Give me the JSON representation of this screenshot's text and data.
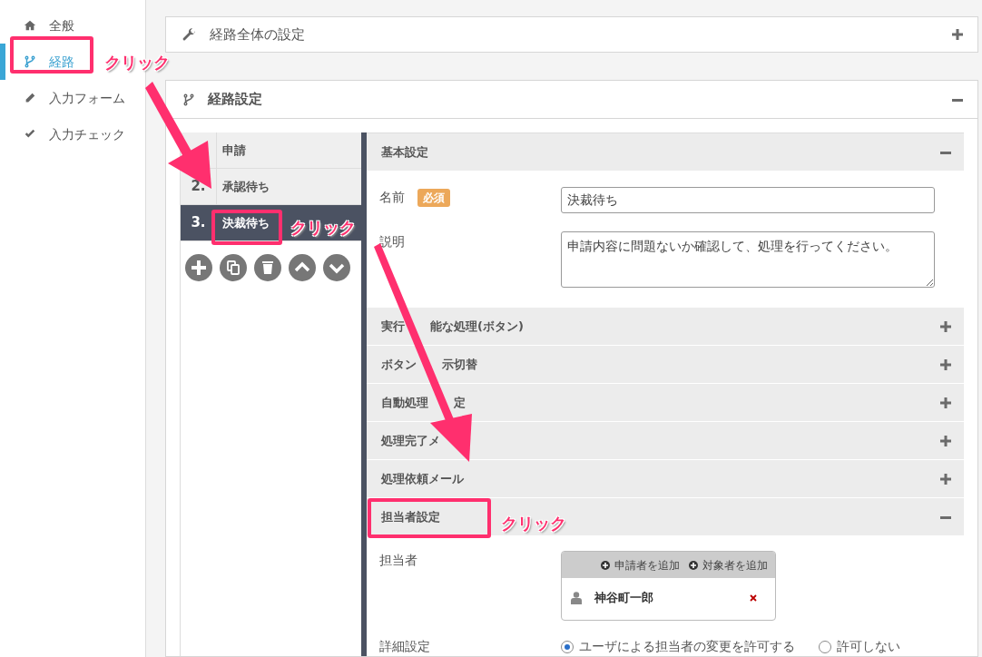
{
  "sidebar": {
    "items": [
      {
        "label": "全般",
        "selected": false
      },
      {
        "label": "経路",
        "selected": true
      },
      {
        "label": "入力フォーム",
        "selected": false
      },
      {
        "label": "入力チェック",
        "selected": false
      }
    ]
  },
  "global_panel": {
    "title": "経路全体の設定",
    "expanded": false
  },
  "route_panel": {
    "title": "経路設定",
    "expanded": true,
    "steps": [
      {
        "label": "申請",
        "selected": false
      },
      {
        "number": "2.",
        "label": "承認待ち",
        "selected": false
      },
      {
        "number": "3.",
        "label": "決裁待ち",
        "selected": true
      }
    ],
    "sections": [
      {
        "kind": "form",
        "title_parts": [
          "基本設定"
        ],
        "expanded": true,
        "fields": [
          {
            "kind": "input",
            "label": "名前",
            "badge": "必須",
            "value": "決裁待ち"
          },
          {
            "kind": "textarea",
            "label": "説明",
            "value": "申請内容に問題ないか確認して、処理を行ってください。"
          }
        ]
      },
      {
        "kind": "plain",
        "title_parts": [
          "実行",
          "能な処理(ボタン)"
        ],
        "expanded": false
      },
      {
        "kind": "plain",
        "title_parts": [
          "ボタン",
          "示切替"
        ],
        "expanded": false
      },
      {
        "kind": "plain",
        "title_parts": [
          "自動処理",
          "定"
        ],
        "expanded": false
      },
      {
        "kind": "plain",
        "title_parts": [
          "処理完了メ"
        ],
        "expanded": false
      },
      {
        "kind": "plain",
        "title_parts": [
          "処理依頼メール"
        ],
        "expanded": false
      },
      {
        "kind": "assignee",
        "title_parts": [
          "担当者設定"
        ],
        "expanded": true,
        "assignee_label": "担当者",
        "add_buttons": [
          "申請者を追加",
          "対象者を追加"
        ],
        "people": [
          "神谷町一郎"
        ],
        "detail_label": "詳細設定",
        "options": [
          {
            "label": "ユーザによる担当者の変更を許可する",
            "selected": true
          },
          {
            "label": "許可しない",
            "selected": false
          }
        ]
      }
    ]
  },
  "annotations": {
    "callouts": [
      "クリック",
      "クリック",
      "クリック"
    ]
  }
}
